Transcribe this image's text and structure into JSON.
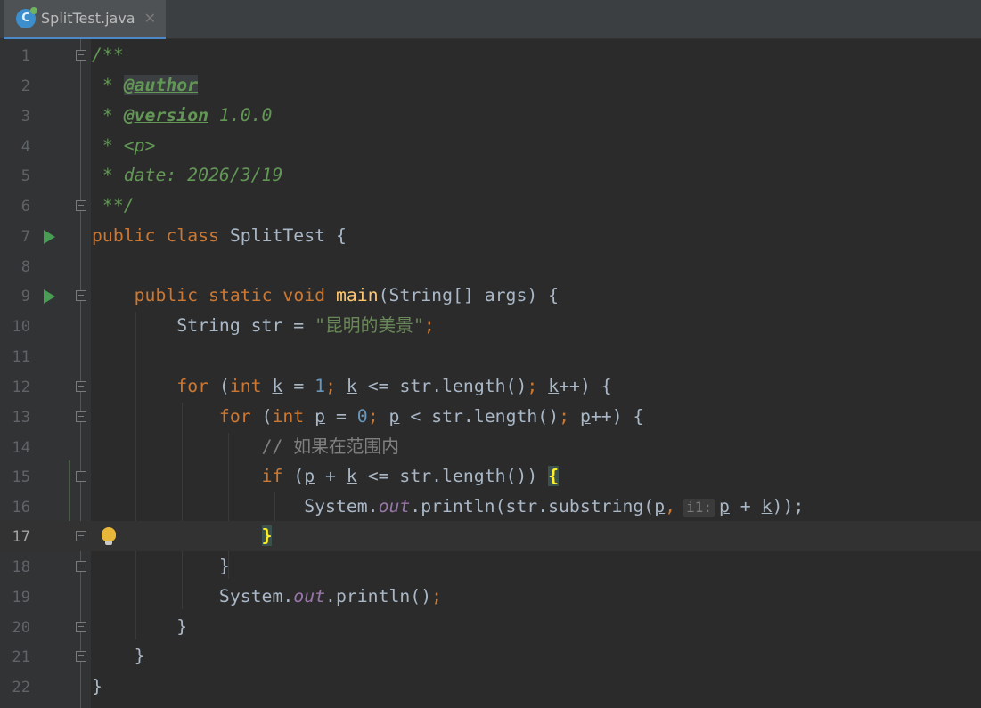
{
  "tab": {
    "title": "SplitTest.java",
    "close": "✕",
    "icon_letter": "C"
  },
  "lines": [
    {
      "n": "1"
    },
    {
      "n": "2"
    },
    {
      "n": "3"
    },
    {
      "n": "4"
    },
    {
      "n": "5"
    },
    {
      "n": "6"
    },
    {
      "n": "7"
    },
    {
      "n": "8"
    },
    {
      "n": "9"
    },
    {
      "n": "10"
    },
    {
      "n": "11"
    },
    {
      "n": "12"
    },
    {
      "n": "13"
    },
    {
      "n": "14"
    },
    {
      "n": "15"
    },
    {
      "n": "16"
    },
    {
      "n": "17"
    },
    {
      "n": "18"
    },
    {
      "n": "19"
    },
    {
      "n": "20"
    },
    {
      "n": "21"
    },
    {
      "n": "22"
    }
  ],
  "code": {
    "l1": "/**",
    "l2_star": " * ",
    "l2_tag": "@author",
    "l3_star": " * ",
    "l3_tag": "@version",
    "l3_val": " 1.0.0",
    "l4": " * <p>",
    "l5": " * date: 2026/3/19",
    "l6": " **/",
    "kw_public": "public",
    "kw_class": "class",
    "class_name": " SplitTest {",
    "kw_static": "static",
    "kw_void": "void",
    "method_name": "main",
    "main_params": "(String[] args) {",
    "string_type": "String str = ",
    "string_literal": "\"昆明的美景\"",
    "semicolon": ";",
    "kw_for": "for",
    "kw_int": "int",
    "var_k": "k",
    "var_p": "p",
    "num_1": "1",
    "num_0": "0",
    "op_assign": " = ",
    "op_le": " <= ",
    "op_lt": " < ",
    "str_length": "str.length()",
    "inc_close": "++) {",
    "comment_cn": "// 如果在范围内",
    "kw_if": "if",
    "if_cond_mid": " + ",
    "if_cond_end": " <= str.length()) ",
    "open_brace": "{",
    "close_brace": "}",
    "sys": "System.",
    "out": "out",
    "println_sub": ".println(str.substring(",
    "hint": "i1:",
    "plus": " + ",
    "end_call": "));",
    "println_empty": ".println()",
    "paren_open": " (",
    "paren_sp": "; "
  }
}
